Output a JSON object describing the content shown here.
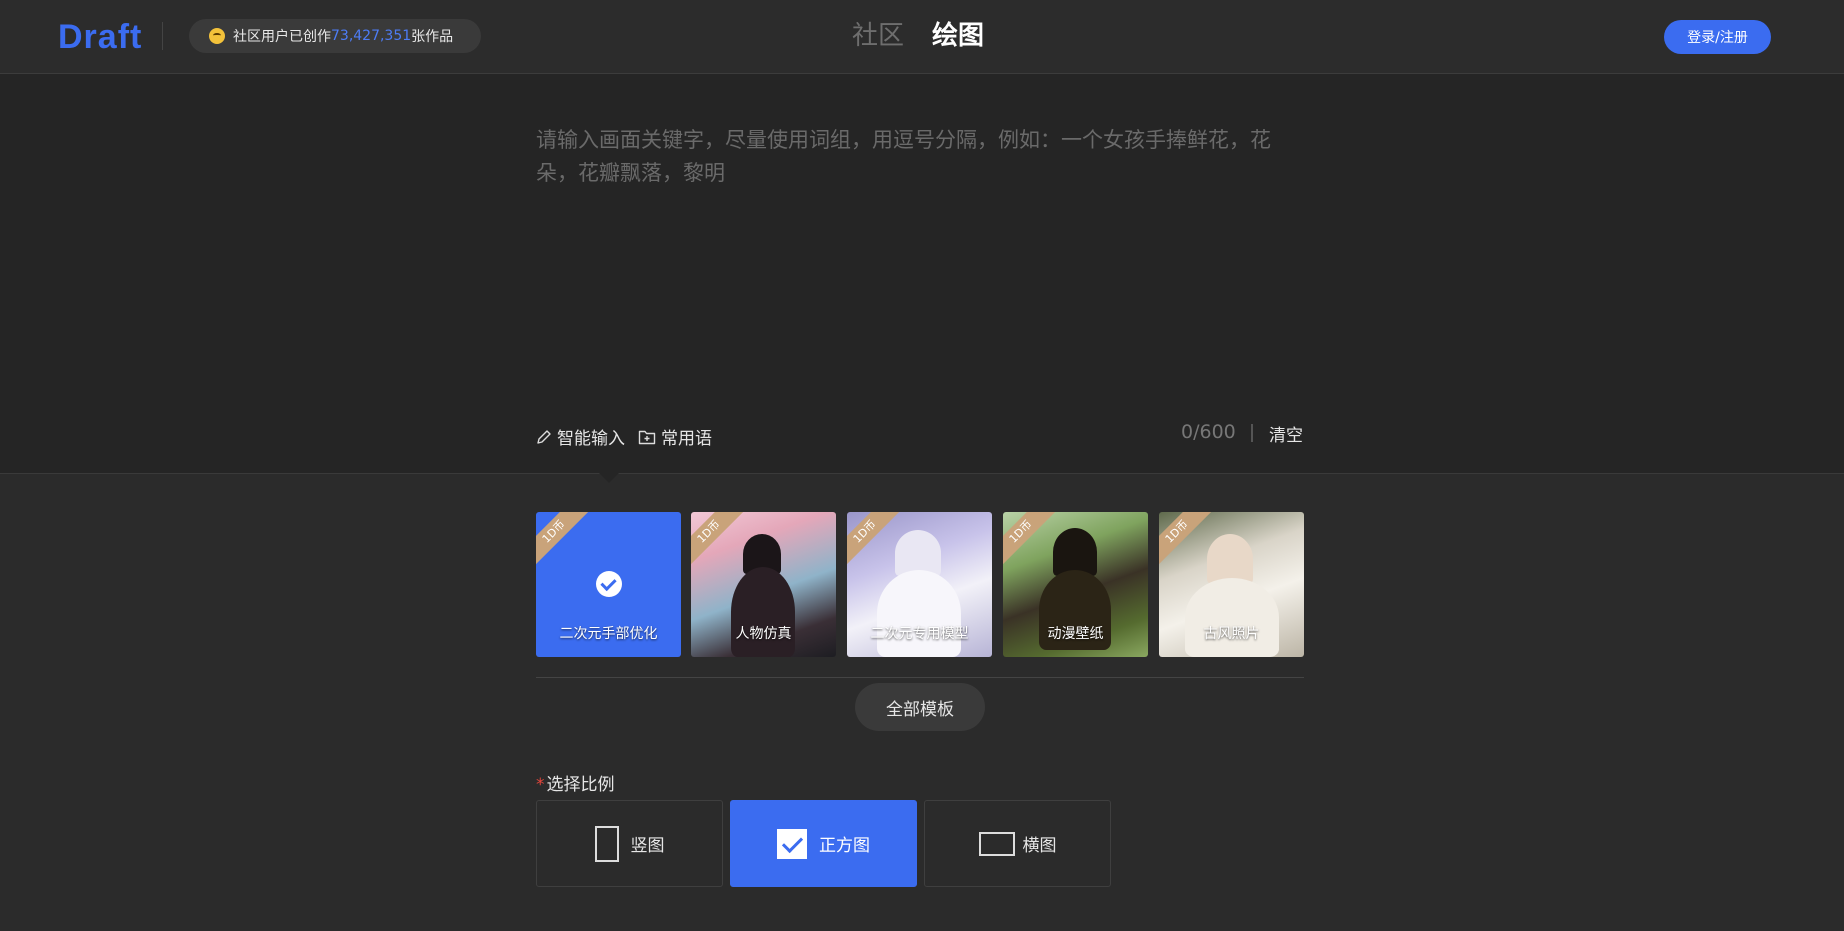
{
  "header": {
    "logo": "Draft",
    "stat_prefix": "社区用户已创作",
    "stat_count": "73,427,351",
    "stat_suffix": "张作品",
    "nav_community": "社区",
    "nav_draw": "绘图",
    "login_label": "登录/注册"
  },
  "prompt": {
    "placeholder": "请输入画面关键字，尽量使用词组，用逗号分隔，例如：一个女孩手捧鲜花，花朵，花瓣飘落，黎明",
    "smart_input_label": "智能输入",
    "common_phrases_label": "常用语",
    "counter": "0/600",
    "clear_label": "清空"
  },
  "templates": {
    "items": [
      {
        "label": "二次元手部优化",
        "price": "1D币"
      },
      {
        "label": "人物仿真",
        "price": "1D币"
      },
      {
        "label": "二次元专用模型",
        "price": "1D币"
      },
      {
        "label": "动漫壁纸",
        "price": "1D币"
      },
      {
        "label": "古风照片",
        "price": "1D币"
      }
    ],
    "all_label": "全部模板"
  },
  "ratio": {
    "title": "选择比例",
    "options": [
      {
        "label": "竖图"
      },
      {
        "label": "正方图"
      },
      {
        "label": "横图"
      }
    ]
  },
  "colors": {
    "accent": "#3b6cf0",
    "background": "#2b2b2b",
    "ribbon": "#c9a37a"
  }
}
